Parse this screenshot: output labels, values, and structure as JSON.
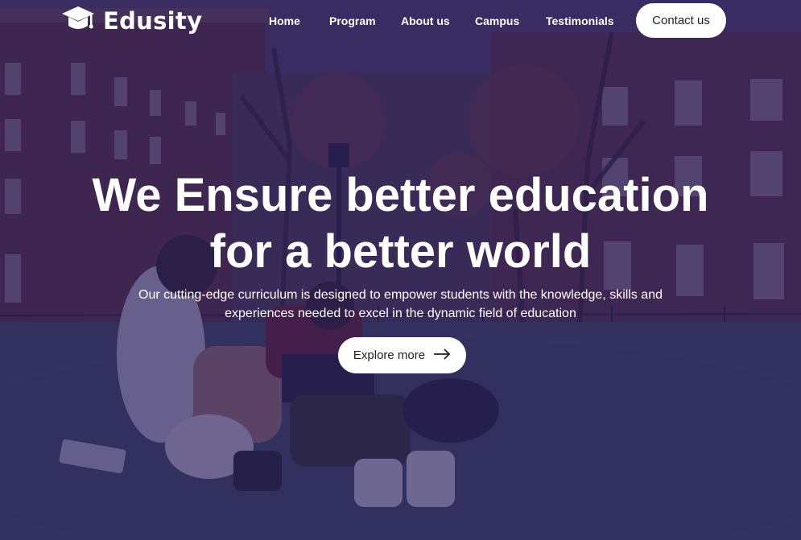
{
  "brand": {
    "name": "Edusity",
    "icon": "graduation-cap-icon"
  },
  "nav": {
    "items": [
      "Home",
      "Program",
      "About us",
      "Campus",
      "Testimonials"
    ],
    "contact_label": "Contact us"
  },
  "hero": {
    "headline_line1": "We Ensure better education",
    "headline_line2": "for a better world",
    "subtext_line1": "Our cutting-edge curriculum is designed to empower students with the knowledge, skills and",
    "subtext_line2": "experiences needed to excel in the dynamic field of education",
    "cta_label": "Explore more",
    "cta_icon": "arrow-right-icon"
  },
  "colors": {
    "overlay": "#241858",
    "text": "#ffffff",
    "button_bg": "#ffffff",
    "button_text": "#212121"
  }
}
